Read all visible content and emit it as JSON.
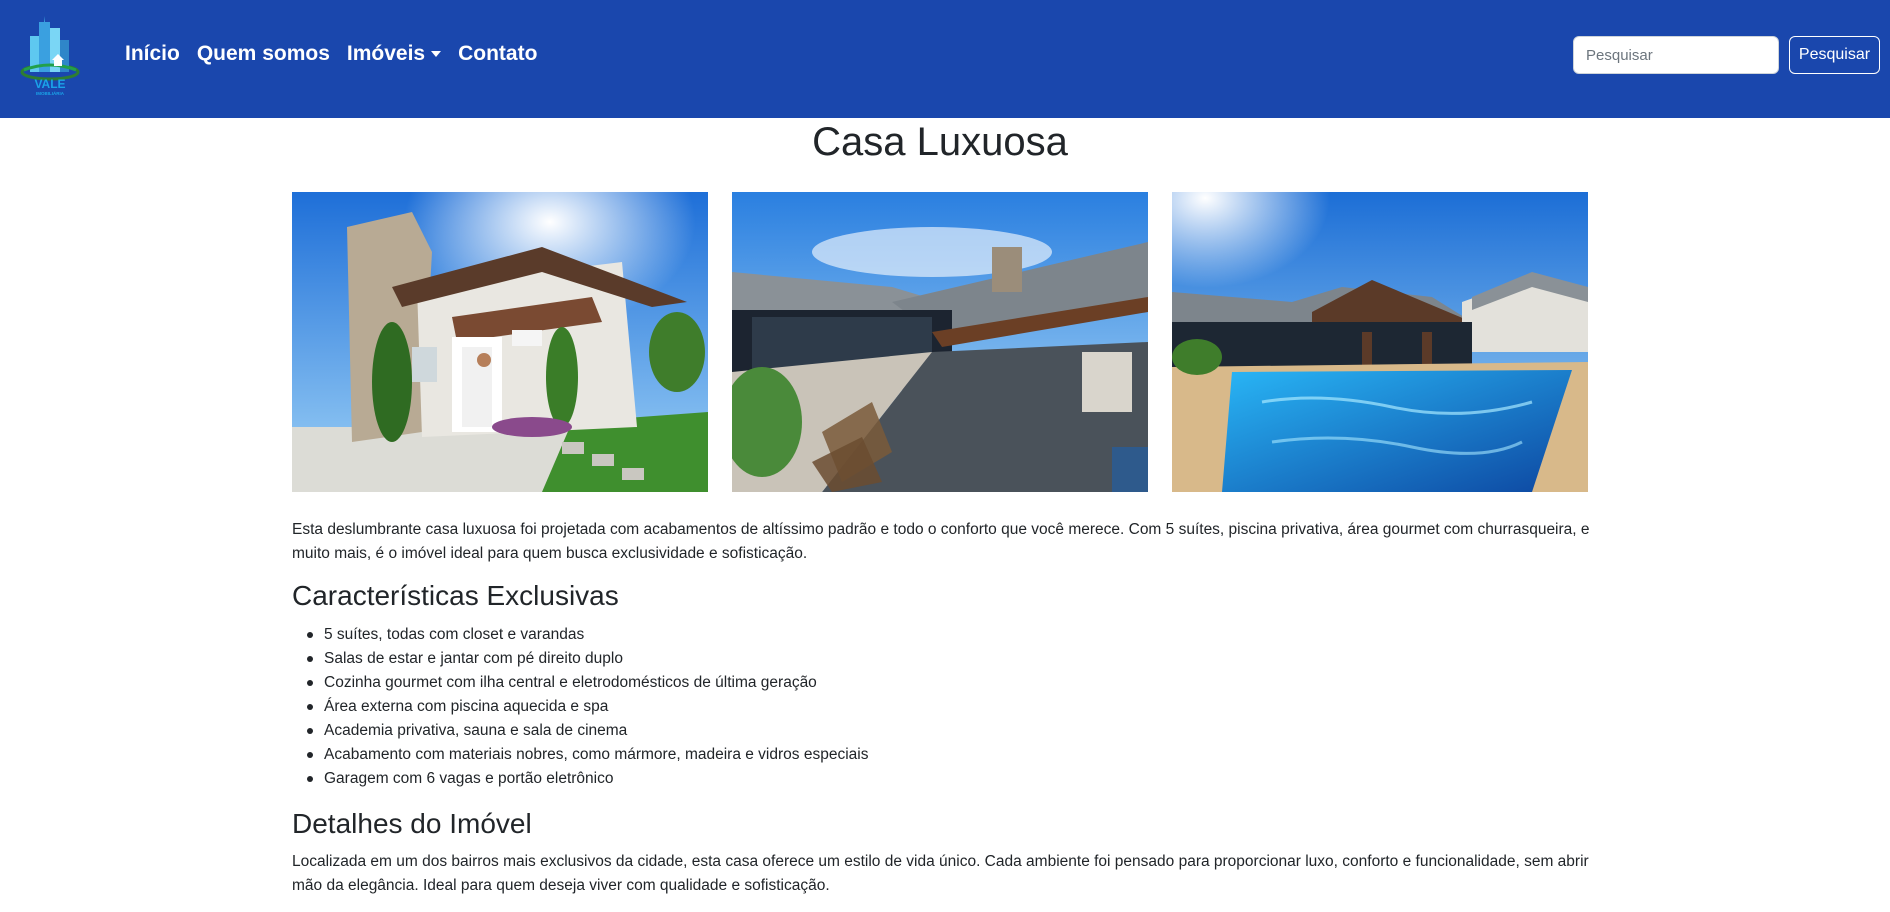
{
  "brand": {
    "logo_text": "VALE",
    "logo_subtext": "IMOBILIÁRIA",
    "colors": {
      "navbar": "#1a47ad",
      "accent": "#2e7d32"
    }
  },
  "nav": {
    "items": [
      {
        "label": "Início"
      },
      {
        "label": "Quem somos"
      },
      {
        "label": "Imóveis",
        "has_dropdown": true
      },
      {
        "label": "Contato"
      }
    ],
    "search": {
      "placeholder": "Pesquisar",
      "value": "",
      "button_label": "Pesquisar"
    }
  },
  "property": {
    "title": "Casa Luxuosa",
    "photos": [
      {
        "icon": "house-facade-photo"
      },
      {
        "icon": "covered-patio-photo"
      },
      {
        "icon": "pool-area-photo"
      }
    ],
    "intro": "Esta deslumbrante casa luxuosa foi projetada com acabamentos de altíssimo padrão e todo o conforto que você merece. Com 5 suítes, piscina privativa, área gourmet com churrasqueira, e muito mais, é o imóvel ideal para quem busca exclusividade e sofisticação.",
    "features_heading": "Características Exclusivas",
    "features": [
      "5 suítes, todas com closet e varandas",
      "Salas de estar e jantar com pé direito duplo",
      "Cozinha gourmet com ilha central e eletrodomésticos de última geração",
      "Área externa com piscina aquecida e spa",
      "Academia privativa, sauna e sala de cinema",
      "Acabamento com materiais nobres, como mármore, madeira e vidros especiais",
      "Garagem com 6 vagas e portão eletrônico"
    ],
    "details_heading": "Detalhes do Imóvel",
    "details": "Localizada em um dos bairros mais exclusivos da cidade, esta casa oferece um estilo de vida único. Cada ambiente foi pensado para proporcionar luxo, conforto e funcionalidade, sem abrir mão da elegância. Ideal para quem deseja viver com qualidade e sofisticação."
  }
}
